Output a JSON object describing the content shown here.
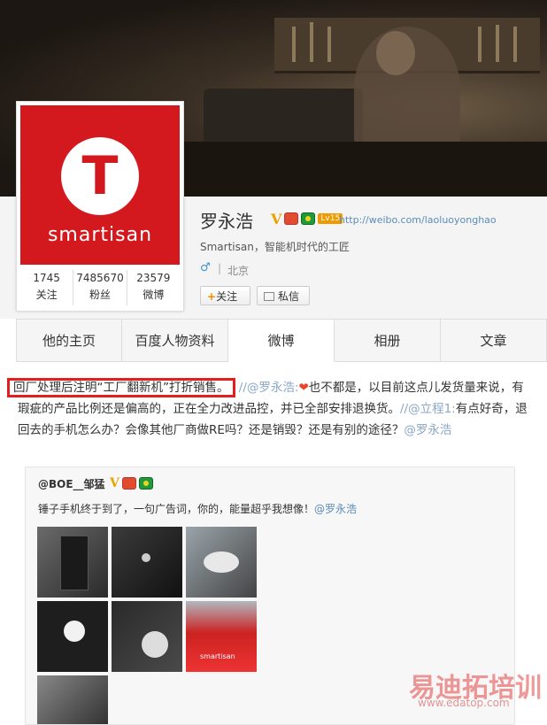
{
  "profile": {
    "name": "罗永浩",
    "level": "Lv15",
    "url": "http://weibo.com/laoluoyonghao",
    "bio": "Smartisan，智能机时代的工匠",
    "gender_icon": "♂",
    "city": "北京",
    "avatar_letter": "T",
    "avatar_brand": "smartisan",
    "avatar_color": "#d4191e",
    "stats": [
      {
        "num": "1745",
        "label": "关注"
      },
      {
        "num": "7485670",
        "label": "粉丝"
      },
      {
        "num": "23579",
        "label": "微博"
      }
    ],
    "follow_label": "关注",
    "message_label": "私信"
  },
  "tabs": [
    "他的主页",
    "百度人物资料",
    "微博",
    "相册",
    "文章"
  ],
  "post": {
    "highlight": "回厂处理后注明“工厂翻新机”打折销售。",
    "mention1": "//@罗永浩:",
    "text1": "也不都是，以目前这点儿发货量来说，有瑕疵的产品比例还是偏高的，正在全力改进品控，并已全部安排退换货。",
    "mention2": "//@立程1:",
    "text2": "有点好奇，退回去的手机怎么办？会像其他厂商做RE吗？还是销毁？还是有别的途径？",
    "mention3": "@罗永浩"
  },
  "repost": {
    "user": "@BOE__邹猛",
    "text": "锤子手机终于到了，一句广告词，你的，能量超乎我想像！",
    "mention": "@罗永浩"
  },
  "watermark": {
    "title": "易迪拓培训",
    "url": "www.edatop.com"
  }
}
